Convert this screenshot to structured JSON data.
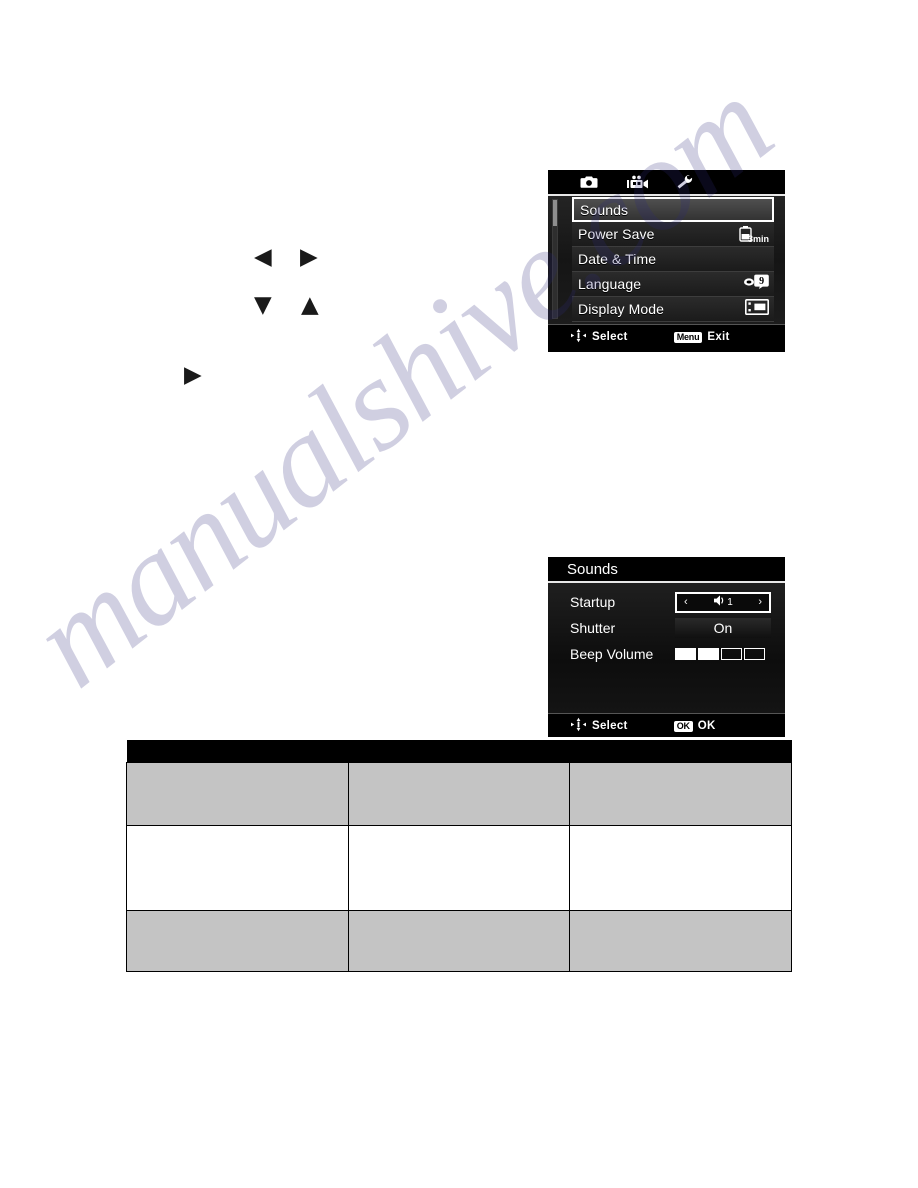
{
  "page": {
    "watermark": "manualshive.com"
  },
  "nav_glyphs": [
    {
      "name": "arrow-left",
      "char": "◀"
    },
    {
      "name": "arrow-right",
      "char": "▶"
    },
    {
      "name": "arrow-down",
      "char": "▼"
    },
    {
      "name": "arrow-up",
      "char": "▲"
    },
    {
      "name": "arrow-right-lower",
      "char": "▶"
    }
  ],
  "settings_screen": {
    "tabs": [
      {
        "icon": "camera-icon",
        "label": "Capture"
      },
      {
        "icon": "video-camera-icon",
        "label": "Video"
      },
      {
        "icon": "wrench-icon",
        "label": "Setup"
      }
    ],
    "active_tab_index": 2,
    "menu_items": [
      {
        "label": "Sounds",
        "value": "",
        "icon": "",
        "selected": true
      },
      {
        "label": "Power Save",
        "value": "3min",
        "icon": "battery-icon",
        "selected": false
      },
      {
        "label": "Date & Time",
        "value": "",
        "icon": "",
        "selected": false
      },
      {
        "label": "Language",
        "value": "",
        "icon": "language-icon",
        "selected": false
      },
      {
        "label": "Display Mode",
        "value": "",
        "icon": "display-mode-icon",
        "selected": false
      }
    ],
    "statusbar": {
      "select_label": "Select",
      "select_icon": "four-way-select-icon",
      "exit_badge": "Menu",
      "exit_label": "Exit"
    }
  },
  "sounds_screen": {
    "title": "Sounds",
    "rows": [
      {
        "label": "Startup",
        "control": "selector",
        "value": "1",
        "icon": "speaker-icon",
        "prev": "‹",
        "next": "›"
      },
      {
        "label": "Shutter",
        "control": "flat",
        "value": "On"
      },
      {
        "label": "Beep Volume",
        "control": "bars",
        "filled": 2,
        "total": 4
      }
    ],
    "statusbar": {
      "select_label": "Select",
      "select_icon": "four-way-select-icon",
      "ok_badge": "OK",
      "ok_label": "OK"
    }
  },
  "spec_table": {
    "header": "",
    "rows": [
      {
        "cells": [
          "",
          "",
          ""
        ]
      },
      {
        "cells": [
          "",
          "",
          ""
        ]
      },
      {
        "cells": [
          "",
          "",
          ""
        ]
      }
    ]
  }
}
